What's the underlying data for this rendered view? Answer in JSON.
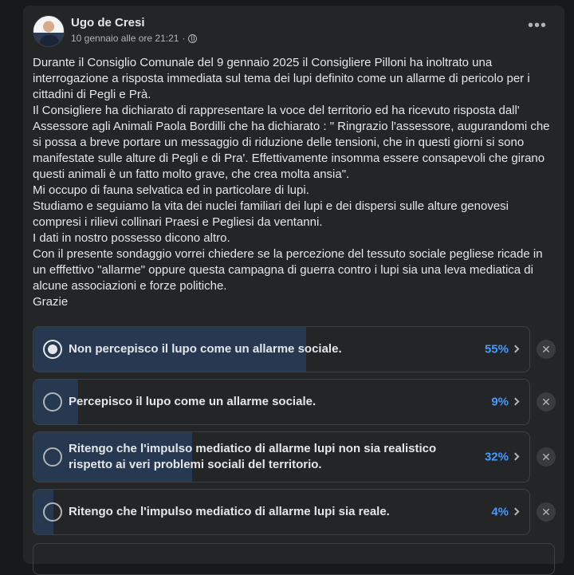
{
  "post": {
    "author": "Ugo de Cresi",
    "timestamp": "10 gennaio alle ore 21:21",
    "separator": "·",
    "more_icon": "more-horizontal-icon",
    "privacy_icon": "globe-icon",
    "text": "Durante il Consiglio Comunale del 9 gennaio 2025 il Consigliere Pilloni ha inoltrato una interrogazione a risposta immediata sul tema dei lupi definito come un allarme di pericolo per i cittadini di Pegli e Prà.\nIl Consigliere ha dichiarato di rappresentare la voce del territorio ed ha ricevuto risposta dall' Assessore agli Animali Paola Bordilli che ha dichiarato : \" Ringrazio l'assessore, augurandomi che si possa a breve portare un messaggio di riduzione delle tensioni, che in questi giorni si sono manifestate sulle alture di Pegli e di Pra'. Effettivamente insomma essere consapevoli che girano questi animali è un fatto molto grave, che crea molta ansia\".\nMi occupo di fauna selvatica ed in particolare di lupi.\nStudiamo e seguiamo la vita dei nuclei familiari dei lupi e dei dispersi sulle alture genovesi compresi i rilievi collinari Praesi e Pegliesi da ventanni.\nI dati in nostro possesso dicono altro.\nCon il presente sondaggio vorrei chiedere se la percezione del tessuto sociale pegliese ricade in un efffettivo \"allarme\" oppure questa campagna di guerra contro i lupi sia una leva mediatica di alcune associazioni e forze politiche.\nGrazie"
  },
  "poll": {
    "options": [
      {
        "label": "Non percepisco il lupo come un allarme sociale.",
        "percent_label": "55%",
        "percent": 55,
        "selected": true
      },
      {
        "label": "Percepisco il lupo come un allarme sociale.",
        "percent_label": "9%",
        "percent": 9,
        "selected": false
      },
      {
        "label": "Ritengo che l'impulso mediatico di allarme lupi non sia realistico rispetto ai veri problemi sociali del territorio.",
        "percent_label": "32%",
        "percent": 32,
        "selected": false
      },
      {
        "label": "Ritengo che l'impulso mediatico di allarme lupi sia reale.",
        "percent_label": "4%",
        "percent": 4,
        "selected": false
      }
    ],
    "remove_icon": "close-icon",
    "chevron_icon": "chevron-right-icon"
  },
  "colors": {
    "background": "#18191a",
    "card": "#242526",
    "fill": "#263951",
    "accent": "#4599ff"
  }
}
